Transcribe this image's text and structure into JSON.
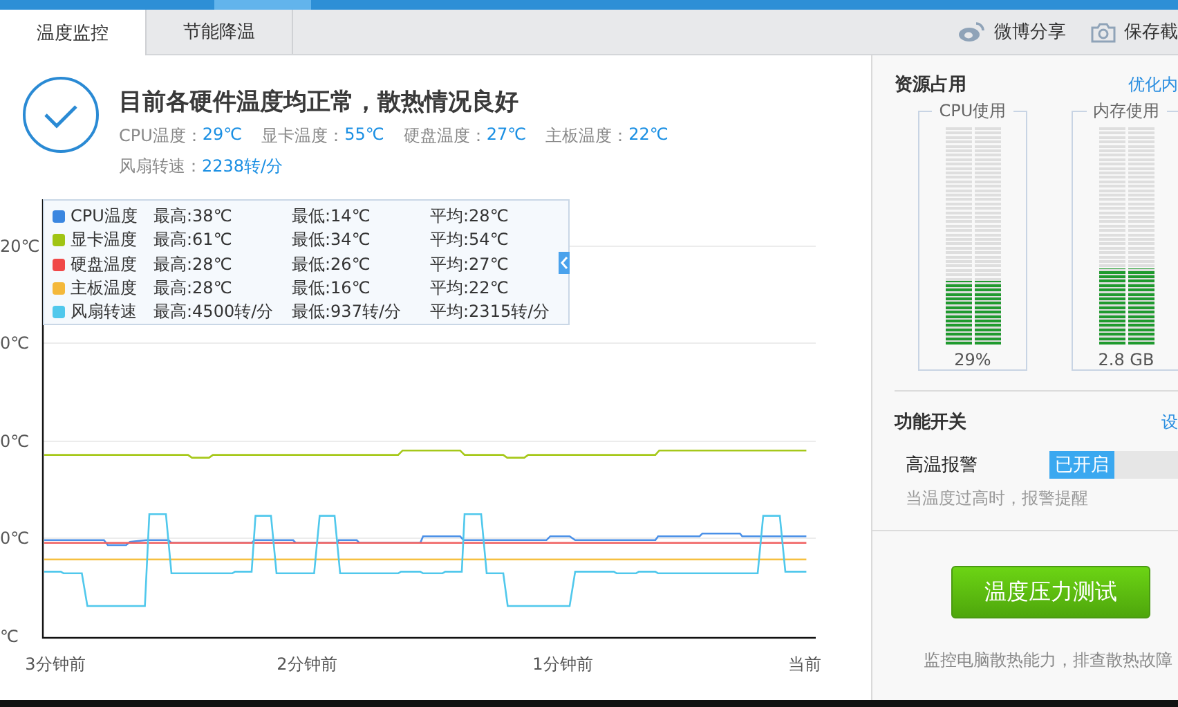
{
  "tabs": [
    {
      "label": "温度监控",
      "selected": true
    },
    {
      "label": "节能降温",
      "selected": false
    }
  ],
  "share_actions": [
    {
      "kind": "weibo",
      "label": "微博分享"
    },
    {
      "kind": "camera",
      "label": "保存截"
    }
  ],
  "status": {
    "title": "目前各硬件温度均正常，散热情况良好",
    "readings": [
      {
        "label": "CPU温度：",
        "value": "29℃"
      },
      {
        "label": "显卡温度：",
        "value": "55℃"
      },
      {
        "label": "硬盘温度：",
        "value": "27℃"
      },
      {
        "label": "主板温度：",
        "value": "22℃"
      }
    ],
    "fan": {
      "label": "风扇转速：",
      "value": "2238转/分"
    }
  },
  "legend": [
    {
      "name": "CPU温度",
      "color": "#3a86e0",
      "max": "最高:38℃",
      "min": "最低:14℃",
      "avg": "平均:28℃"
    },
    {
      "name": "显卡温度",
      "color": "#a0c414",
      "max": "最高:61℃",
      "min": "最低:34℃",
      "avg": "平均:54℃"
    },
    {
      "name": "硬盘温度",
      "color": "#f04848",
      "max": "最高:28℃",
      "min": "最低:26℃",
      "avg": "平均:27℃"
    },
    {
      "name": "主板温度",
      "color": "#f4b83a",
      "max": "最高:28℃",
      "min": "最低:16℃",
      "avg": "平均:22℃"
    },
    {
      "name": "风扇转速",
      "color": "#50c8ec",
      "max": "最高:4500转/分",
      "min": "最低:937转/分",
      "avg": "平均:2315转/分"
    }
  ],
  "chart": {
    "y_labels": [
      "20℃",
      "0℃",
      "0℃",
      "0℃",
      "℃"
    ],
    "x_labels": [
      "3分钟前",
      "2分钟前",
      "1分钟前",
      "当前"
    ]
  },
  "resources": {
    "title": "资源占用",
    "link": "优化内",
    "meters": [
      {
        "label": "CPU使用",
        "level": 0.29,
        "reading": "29%"
      },
      {
        "label": "内存使用",
        "level": 0.35,
        "reading": "2.8 GB"
      }
    ]
  },
  "features": {
    "title": "功能开关",
    "link": "设",
    "switch": {
      "label": "高温报警",
      "on": true,
      "state_text": "已开启",
      "hint": "当温度过高时，报警提醒"
    },
    "button": "温度压力测试",
    "caption": "监控电脑散热能力，排查散热故障"
  }
}
